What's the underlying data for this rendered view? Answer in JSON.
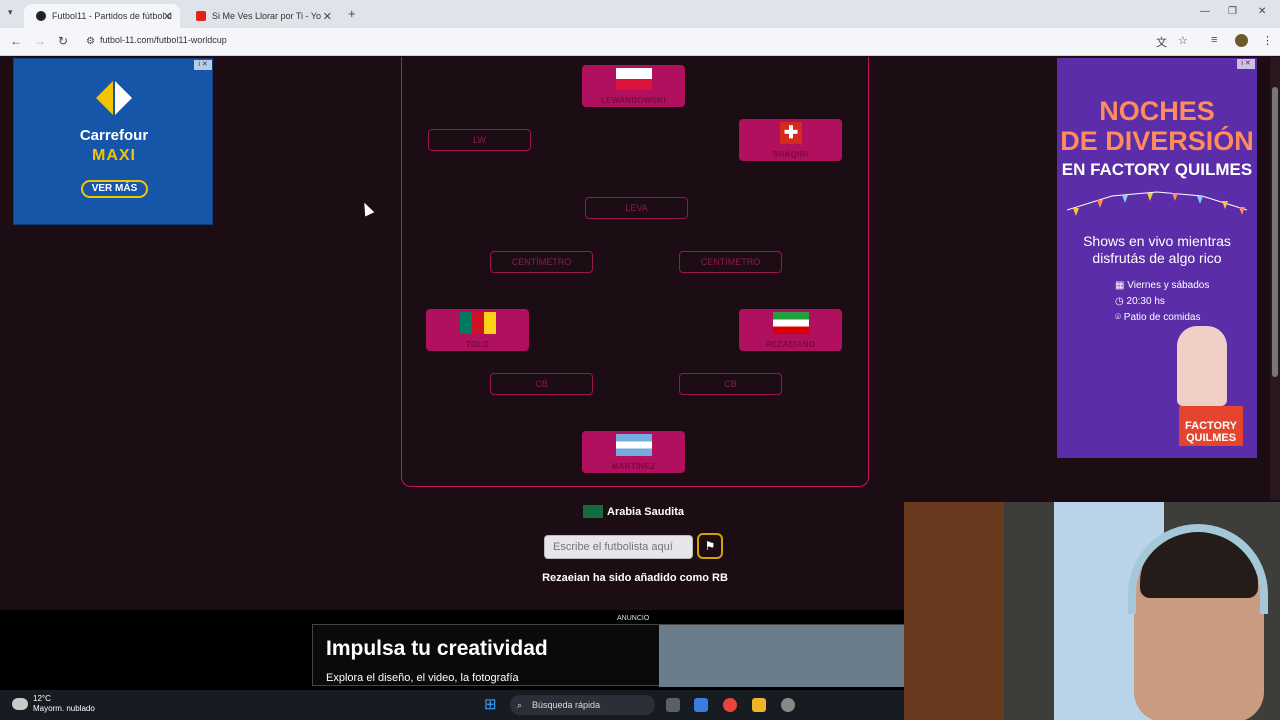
{
  "browser": {
    "tabs": [
      {
        "title": "Futbol11 - Partidos de fútbol d"
      },
      {
        "title": "Si Me Ves Llorar por Ti - Yo"
      }
    ],
    "url": "futbol-11.com/futbol11-worldcup"
  },
  "left_ad": {
    "line1": "Carrefour",
    "line2": "MAXI",
    "button": "VER MÁS"
  },
  "pitch": {
    "players": [
      {
        "name": "LEWANDOWSKI",
        "flag": "poland"
      },
      {
        "name": "SHAQIRI",
        "flag": "switzerland"
      },
      {
        "name": "TOLO",
        "flag": "cameroon"
      },
      {
        "name": "REZAEIANO",
        "flag": "iran"
      },
      {
        "name": "MARTÍNEZ",
        "flag": "argentina"
      }
    ],
    "slots": [
      "LW",
      "LEVA",
      "CENTÍMETRO",
      "CENTÍMETRO",
      "CB",
      "CB"
    ]
  },
  "country": "Arabia Saudita",
  "search": {
    "placeholder": "Escribe el futbolista aquí"
  },
  "status_message": "Rezaeian ha sido añadido como RB",
  "right_ad": {
    "title_line1": "NOCHES",
    "title_line2": "DE DIVERSIÓN",
    "subtitle": "EN FACTORY QUILMES",
    "body": "Shows en vivo mientras disfrutás de algo rico",
    "info": [
      "Viernes y sábados",
      "20:30 hs",
      "Patio de comidas"
    ],
    "brand": "FACTORY QUILMES"
  },
  "bottom_ad": {
    "label": "ANUNCIO",
    "headline": "Impulsa tu creatividad",
    "subline": "Explora el diseño, el video, la fotografía"
  },
  "taskbar": {
    "temperature": "12°C",
    "weather": "Mayorm. nublado",
    "search": "Búsqueda rápida"
  },
  "colors": {
    "page_bg": "#1c0d14",
    "player_bg": "#b0105e",
    "accent": "#c2185b"
  }
}
